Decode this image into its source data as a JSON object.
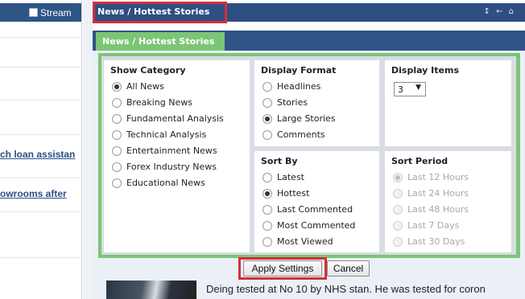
{
  "left": {
    "stream_label": "Stream",
    "links": [
      "ch loan assistan",
      "owrooms after"
    ]
  },
  "widget": {
    "outer_title": "News / Hottest Stories",
    "outer_icons": "↕ ← ⌂",
    "inner_tab_title": "News / Hottest Stories"
  },
  "show_category": {
    "title": "Show Category",
    "options": [
      "All News",
      "Breaking News",
      "Fundamental Analysis",
      "Technical Analysis",
      "Entertainment News",
      "Forex Industry News",
      "Educational News"
    ],
    "selected": "All News"
  },
  "display_format": {
    "title": "Display Format",
    "options": [
      "Headlines",
      "Stories",
      "Large Stories",
      "Comments"
    ],
    "selected": "Large Stories"
  },
  "display_items": {
    "title": "Display Items",
    "value": "3",
    "arrow": "▼"
  },
  "sort_by": {
    "title": "Sort By",
    "options": [
      "Latest",
      "Hottest",
      "Last Commented",
      "Most Commented",
      "Most Viewed"
    ],
    "selected": "Hottest"
  },
  "sort_period": {
    "title": "Sort Period",
    "options": [
      "Last 12 Hours",
      "Last 24 Hours",
      "Last 48 Hours",
      "Last 7 Days",
      "Last 30 Days"
    ],
    "selected": "Last 12 Hours",
    "disabled": true
  },
  "buttons": {
    "apply": "Apply Settings",
    "cancel": "Cancel"
  },
  "article": {
    "snippet": "Deing tested at No 10 by NHS stan.  He was tested for coron"
  },
  "colors": {
    "header_blue": "#2d4f82",
    "tab_green": "#7cc576",
    "highlight_red": "#d62d3a"
  }
}
